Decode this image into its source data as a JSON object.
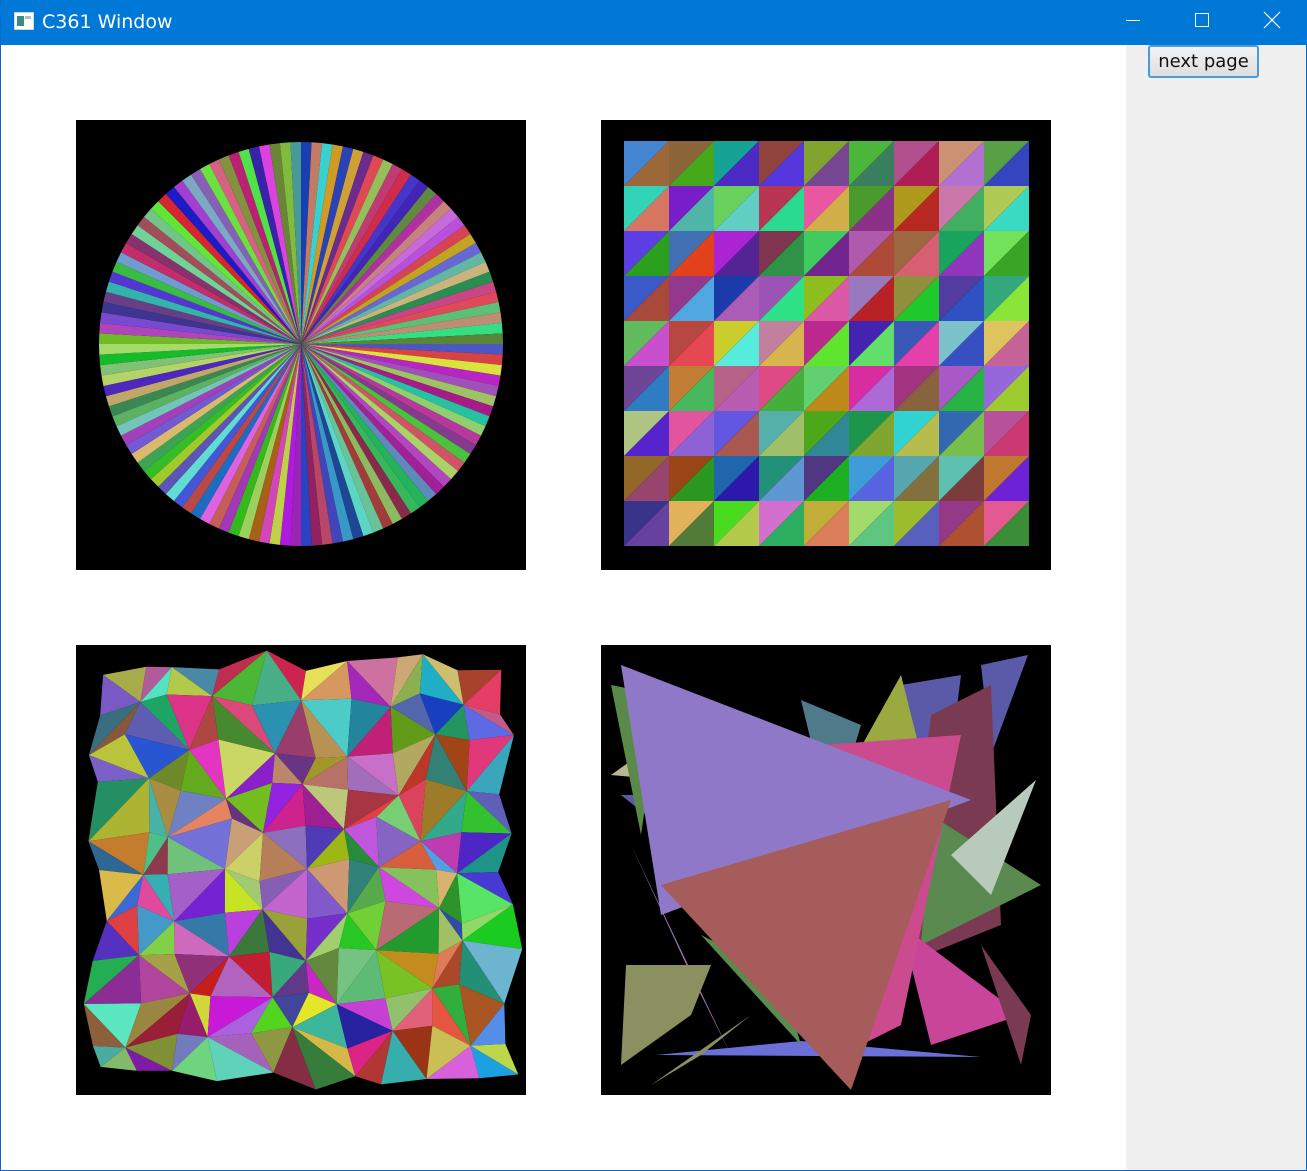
{
  "window": {
    "title": "C361 Window"
  },
  "toolbar": {
    "next_page_label": "next page"
  },
  "icons": {
    "app": "window-app-icon",
    "minimize": "minimize-icon",
    "maximize": "maximize-icon",
    "close": "close-icon"
  },
  "colors": {
    "titlebar": "#0078d7",
    "canvas_background": "#000000",
    "side_panel": "#f0f0f0",
    "button_border": "#4a9ae0"
  },
  "canvases": [
    {
      "name": "pie-canvas",
      "content": "circle of colored triangle fan slices"
    },
    {
      "name": "grid-canvas",
      "content": "9x9 grid of squares each split into two colored triangles"
    },
    {
      "name": "mesh-canvas",
      "content": "jittered triangle mesh with random colors"
    },
    {
      "name": "triangles-canvas",
      "content": "random overlapping large colored triangles"
    }
  ]
}
